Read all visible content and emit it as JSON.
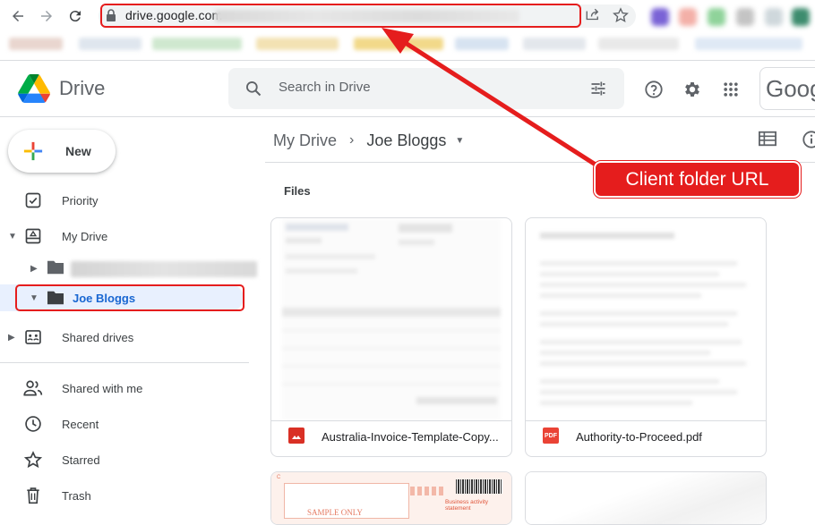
{
  "browser": {
    "url": "drive.google.com",
    "back_icon": "arrow-left-icon",
    "forward_icon": "arrow-right-icon",
    "reload_icon": "reload-icon",
    "lock_icon": "lock-icon",
    "share_icon": "share-icon",
    "star_icon": "star-icon"
  },
  "header": {
    "app_name": "Drive",
    "search_placeholder": "Search in Drive",
    "account_text": "Goog"
  },
  "sidebar": {
    "new_label": "New",
    "items": [
      {
        "label": "Priority",
        "icon": "priority-check-icon"
      },
      {
        "label": "My Drive",
        "icon": "my-drive-icon"
      },
      {
        "label": "Joe Bloggs",
        "icon": "folder-icon",
        "selected": true
      },
      {
        "label": "Shared drives",
        "icon": "shared-drives-icon"
      },
      {
        "label": "Shared with me",
        "icon": "people-icon"
      },
      {
        "label": "Recent",
        "icon": "clock-icon"
      },
      {
        "label": "Starred",
        "icon": "star-outline-icon"
      },
      {
        "label": "Trash",
        "icon": "trash-icon"
      }
    ]
  },
  "breadcrumb": {
    "root": "My Drive",
    "separator": "›",
    "current": "Joe Bloggs"
  },
  "main": {
    "section_title": "Files",
    "files": [
      {
        "name": "Australia-Invoice-Template-Copy...",
        "type": "image",
        "icon_color": "#d93025"
      },
      {
        "name": "Authority-to-Proceed.pdf",
        "type": "pdf",
        "icon_label": "PDF",
        "icon_color": "#ea4335"
      }
    ]
  },
  "annotation": {
    "callout_text": "Client folder URL",
    "color": "#e51d1d"
  },
  "partial_thumbnail_text": {
    "sample": "SAMPLE ONLY",
    "business": "Business activity statement"
  }
}
